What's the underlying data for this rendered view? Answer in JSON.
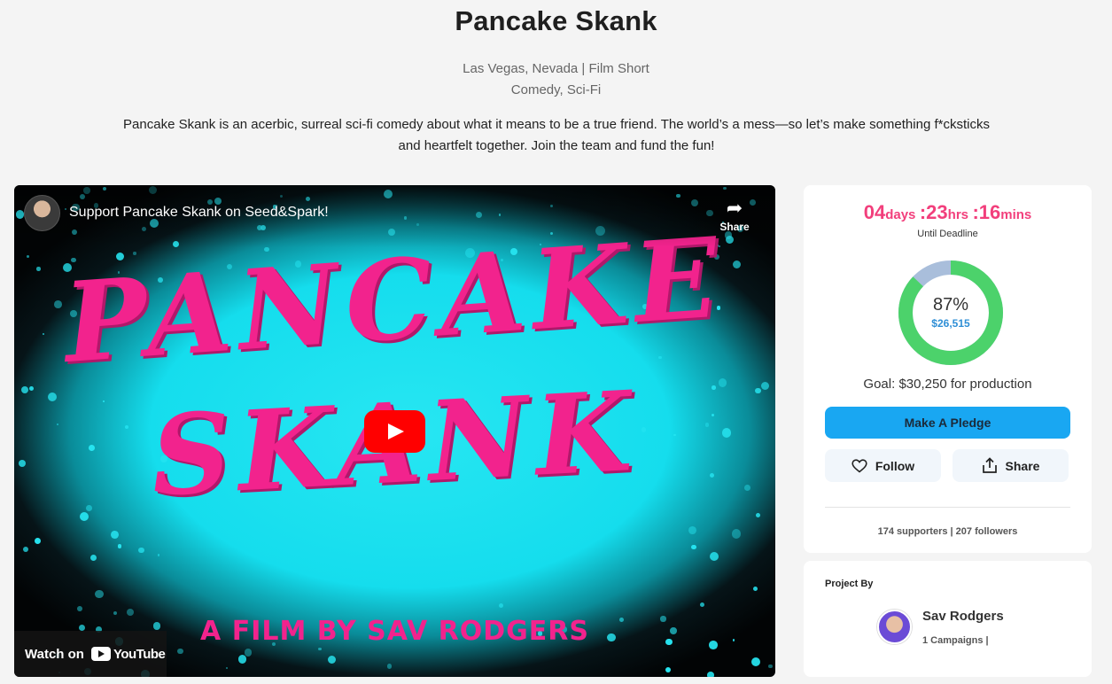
{
  "project": {
    "title": "Pancake Skank",
    "location_line": "Las Vegas, Nevada | Film Short",
    "genres": "Comedy, Sci-Fi",
    "description": "Pancake Skank is an acerbic, surreal sci-fi comedy about what it means to be a true friend. The world’s a mess—so let’s make something f*cksticks and heartfelt together. Join the team and fund the fun!"
  },
  "video": {
    "title": "Support Pancake Skank on Seed&Spark!",
    "share_label": "Share",
    "watch_on_label": "Watch on",
    "youtube_label": "YouTube",
    "poster_line1": "PANCAKE",
    "poster_line2": "SKANK",
    "poster_byline": "A FILM BY SAV RODGERS"
  },
  "funding": {
    "days": "04",
    "days_unit": "days",
    "hours": ":23",
    "hours_unit": "hrs",
    "mins": ":16",
    "mins_unit": "mins",
    "until_label": "Until Deadline",
    "percent_label": "87%",
    "percent_value": 0.87,
    "raised": "$26,515",
    "goal": "Goal: $30,250 for production",
    "pledge_label": "Make A Pledge",
    "follow_label": "Follow",
    "share_label": "Share",
    "stats": "174 supporters | 207 followers",
    "colors": {
      "progress": "#4cd26b",
      "remaining": "#a9bedb",
      "countdown": "#f23f7c",
      "pledge": "#19a7f2"
    }
  },
  "creator": {
    "section_label": "Project By",
    "name": "Sav Rodgers",
    "campaigns": "1 Campaigns |"
  }
}
